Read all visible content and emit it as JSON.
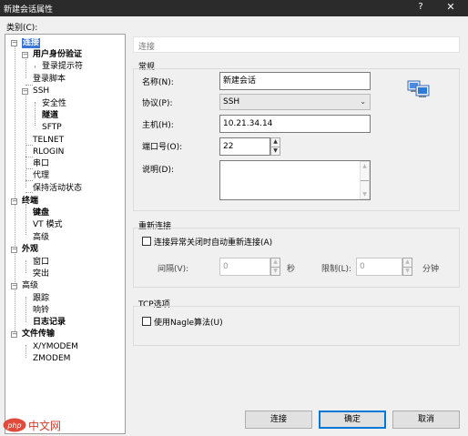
{
  "window": {
    "title": "新建会话属性",
    "help": "?",
    "close": "✕"
  },
  "category_label": "类别(C):",
  "tree": [
    {
      "label": "连接",
      "bold": true,
      "selected": true,
      "expander": "−"
    },
    {
      "label": "用户身份验证",
      "bold": true,
      "expander": "−"
    },
    {
      "label": "登录提示符"
    },
    {
      "label": "登录脚本"
    },
    {
      "label": "SSH",
      "expander": "−"
    },
    {
      "label": "安全性"
    },
    {
      "label": "隧道",
      "bold": true
    },
    {
      "label": "SFTP"
    },
    {
      "label": "TELNET"
    },
    {
      "label": "RLOGIN"
    },
    {
      "label": "串口"
    },
    {
      "label": "代理"
    },
    {
      "label": "保持活动状态"
    },
    {
      "label": "终端",
      "bold": true,
      "expander": "−"
    },
    {
      "label": "键盘",
      "bold": true
    },
    {
      "label": "VT 模式"
    },
    {
      "label": "高级"
    },
    {
      "label": "外观",
      "bold": true,
      "expander": "−"
    },
    {
      "label": "窗口"
    },
    {
      "label": "突出"
    },
    {
      "label": "高级",
      "expander": "−"
    },
    {
      "label": "跟踪"
    },
    {
      "label": "响铃"
    },
    {
      "label": "日志记录",
      "bold": true
    },
    {
      "label": "文件传输",
      "bold": true,
      "expander": "−"
    },
    {
      "label": "X/YMODEM"
    },
    {
      "label": "ZMODEM"
    }
  ],
  "header": "连接",
  "general": {
    "title": "常规",
    "name_label": "名称(N):",
    "name_value": "新建会话",
    "protocol_label": "协议(P):",
    "protocol_value": "SSH",
    "host_label": "主机(H):",
    "host_value": "10.21.34.14",
    "port_label": "端口号(O):",
    "port_value": "22",
    "desc_label": "说明(D):",
    "desc_value": "",
    "icon": "network-computers-icon"
  },
  "reconnect": {
    "title": "重新连接",
    "checkbox_label": "连接异常关闭时自动重新连接(A)",
    "checked": false,
    "interval_label": "间隔(V):",
    "interval_value": "0",
    "interval_unit": "秒",
    "limit_label": "限制(L):",
    "limit_value": "0",
    "limit_unit": "分钟"
  },
  "tcp": {
    "title": "TCP选项",
    "nagle_label": "使用Nagle算法(U)",
    "checked": false
  },
  "buttons": {
    "connect": "连接",
    "ok": "确定",
    "cancel": "取消"
  },
  "watermark": {
    "logo": "php",
    "text": "中文网"
  },
  "colors": {
    "selection": "#3874d8",
    "default_button_border": "#0078d7",
    "titlebar": "#2b2b2b"
  }
}
